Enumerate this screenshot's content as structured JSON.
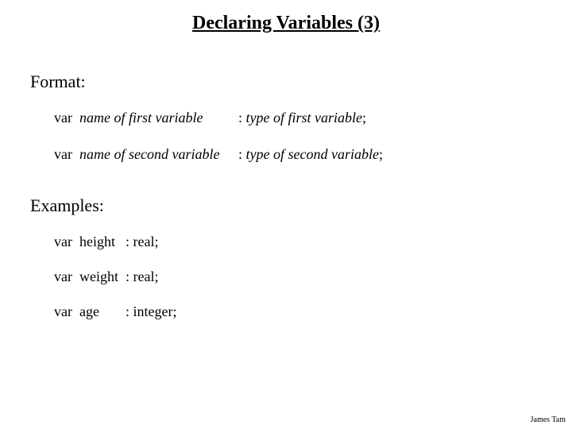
{
  "title": "Declaring Variables (3)",
  "sections": {
    "format_label": "Format:",
    "examples_label": "Examples:"
  },
  "format_lines": [
    {
      "kw": "var",
      "name": "name of first variable",
      "sep": ": ",
      "type": "type of first variable",
      "term": ";"
    },
    {
      "kw": "var",
      "name": "name of second variable",
      "sep": ": ",
      "type": "type of second variable",
      "term": ";"
    }
  ],
  "example_lines": [
    {
      "kw": "var",
      "name": "height",
      "sep": ": ",
      "type": "real;",
      "name_pad": "height "
    },
    {
      "kw": "var",
      "name": "weight",
      "sep": ": ",
      "type": "real;",
      "name_pad": "weight"
    },
    {
      "kw": "var",
      "name": "age",
      "sep": ": ",
      "type": "integer;",
      "name_pad": "age      "
    }
  ],
  "footer": "James Tam"
}
